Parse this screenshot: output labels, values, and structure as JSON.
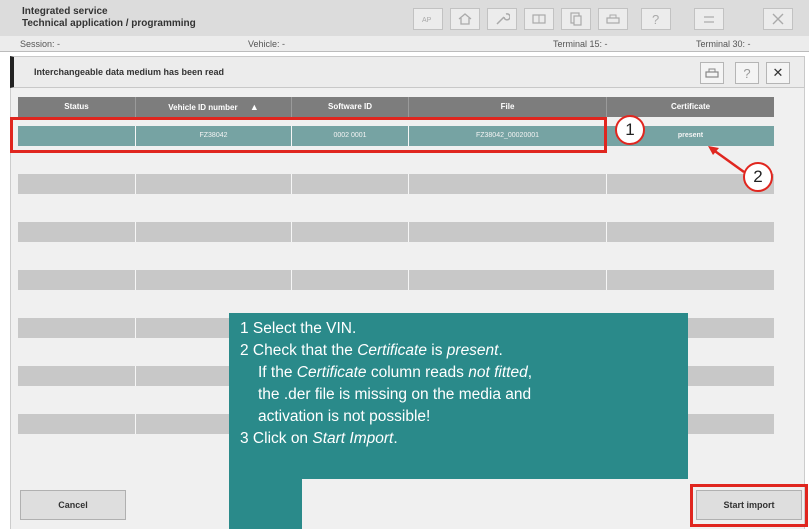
{
  "header": {
    "title": "Integrated service",
    "subtitle": "Technical application / programming",
    "toolbar_icons": [
      "ap-icon",
      "home-icon",
      "wrench-icon",
      "display-icon",
      "copy-icon",
      "printer-icon",
      "help-icon",
      "minimize-icon",
      "close-icon"
    ]
  },
  "info_bar": {
    "session": "Session:  -",
    "vehicle": "Vehicle:  -",
    "terminal15": "Terminal 15:  -",
    "terminal30": "Terminal 30:  -"
  },
  "dialog": {
    "title": "Interchangeable data medium has been read",
    "help_glyph": "?",
    "close_glyph": "✕"
  },
  "table": {
    "columns": [
      "Status",
      "Vehicle ID number",
      "Software ID",
      "File",
      "Certificate"
    ],
    "sort_glyph": "▲",
    "rows": [
      {
        "status": "",
        "vin": "FZ38042",
        "software_id": "0002 0001",
        "file": "FZ38042_00020001",
        "certificate": "present"
      }
    ]
  },
  "annotations": {
    "marker1": "1",
    "marker2": "2",
    "lines": [
      {
        "segments": [
          {
            "t": "1 Select the VIN.",
            "i": false
          }
        ]
      },
      {
        "segments": [
          {
            "t": "2 Check that the ",
            "i": false
          },
          {
            "t": "Certificate",
            "i": true
          },
          {
            "t": " is ",
            "i": false
          },
          {
            "t": "present",
            "i": true
          },
          {
            "t": ".",
            "i": false
          }
        ]
      },
      {
        "indent": true,
        "segments": [
          {
            "t": "If the ",
            "i": false
          },
          {
            "t": "Certificate",
            "i": true
          },
          {
            "t": " column reads ",
            "i": false
          },
          {
            "t": "not fitted",
            "i": true
          },
          {
            "t": ",",
            "i": false
          }
        ]
      },
      {
        "indent": true,
        "segments": [
          {
            "t": "the .der file is missing on the media and",
            "i": false
          }
        ]
      },
      {
        "indent": true,
        "segments": [
          {
            "t": "activation is not possible!",
            "i": false
          }
        ]
      },
      {
        "segments": [
          {
            "t": "3 Click on ",
            "i": false
          },
          {
            "t": "Start Import",
            "i": true
          },
          {
            "t": ".",
            "i": false
          }
        ]
      }
    ]
  },
  "buttons": {
    "cancel": "Cancel",
    "start_import": "Start import"
  },
  "colors": {
    "selected_row": "#76a3a3",
    "annotation_red": "#e0261f",
    "callout_teal": "#2a8a8a"
  }
}
